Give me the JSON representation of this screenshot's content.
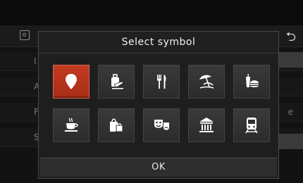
{
  "dialog": {
    "title": "Select symbol",
    "ok_label": "OK"
  },
  "background": {
    "back_icon": "back-arrow-icon",
    "row_letters": [
      "I",
      "A",
      "F",
      "S"
    ],
    "row_right_letter": "e"
  },
  "symbols": [
    {
      "name": "location-pin-icon",
      "selected": true
    },
    {
      "name": "luggage-icon",
      "selected": false
    },
    {
      "name": "fork-knife-icon",
      "selected": false
    },
    {
      "name": "beach-umbrella-icon",
      "selected": false
    },
    {
      "name": "fast-food-icon",
      "selected": false
    },
    {
      "name": "coffee-cup-icon",
      "selected": false
    },
    {
      "name": "shopping-bags-icon",
      "selected": false
    },
    {
      "name": "theater-masks-icon",
      "selected": false
    },
    {
      "name": "museum-icon",
      "selected": false
    },
    {
      "name": "train-icon",
      "selected": false
    }
  ],
  "colors": {
    "selected": "#c23a20",
    "tile": "#353535",
    "dialog_bg": "#1e1e1e"
  }
}
